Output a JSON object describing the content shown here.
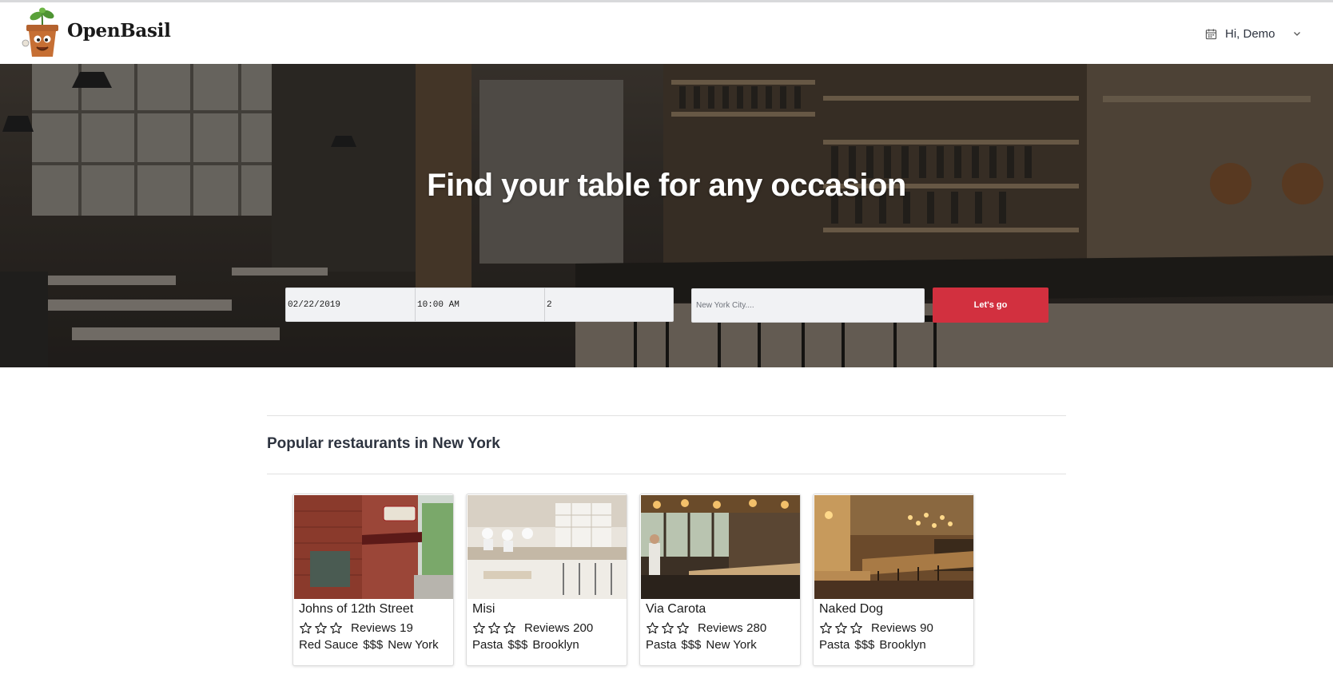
{
  "header": {
    "brand": "OpenBasil",
    "user_greeting": "Hi, Demo",
    "icons": {
      "logo": "potted-basil-logo",
      "calendar": "calendar-icon",
      "chevron": "chevron-down-icon"
    }
  },
  "hero": {
    "title": "Find your table for any occasion",
    "search": {
      "date": "02/22/2019",
      "time": "10:00 AM",
      "party_size": "2",
      "location_placeholder": "New York City....",
      "submit_label": "Let's go"
    },
    "colors": {
      "button": "#d2303f"
    }
  },
  "popular": {
    "title": "Popular restaurants in New York",
    "restaurants": [
      {
        "name": "Johns of 12th Street",
        "stars": 0,
        "reviews_label": "Reviews",
        "reviews": "19",
        "cuisine": "Red Sauce",
        "price": "$$$",
        "area": "New York"
      },
      {
        "name": "Misi",
        "stars": 0,
        "reviews_label": "Reviews",
        "reviews": "200",
        "cuisine": "Pasta",
        "price": "$$$",
        "area": "Brooklyn"
      },
      {
        "name": "Via Carota",
        "stars": 0,
        "reviews_label": "Reviews",
        "reviews": "280",
        "cuisine": "Pasta",
        "price": "$$$",
        "area": "New York"
      },
      {
        "name": "Naked Dog",
        "stars": 0,
        "reviews_label": "Reviews",
        "reviews": "90",
        "cuisine": "Pasta",
        "price": "$$$",
        "area": "Brooklyn"
      }
    ]
  }
}
